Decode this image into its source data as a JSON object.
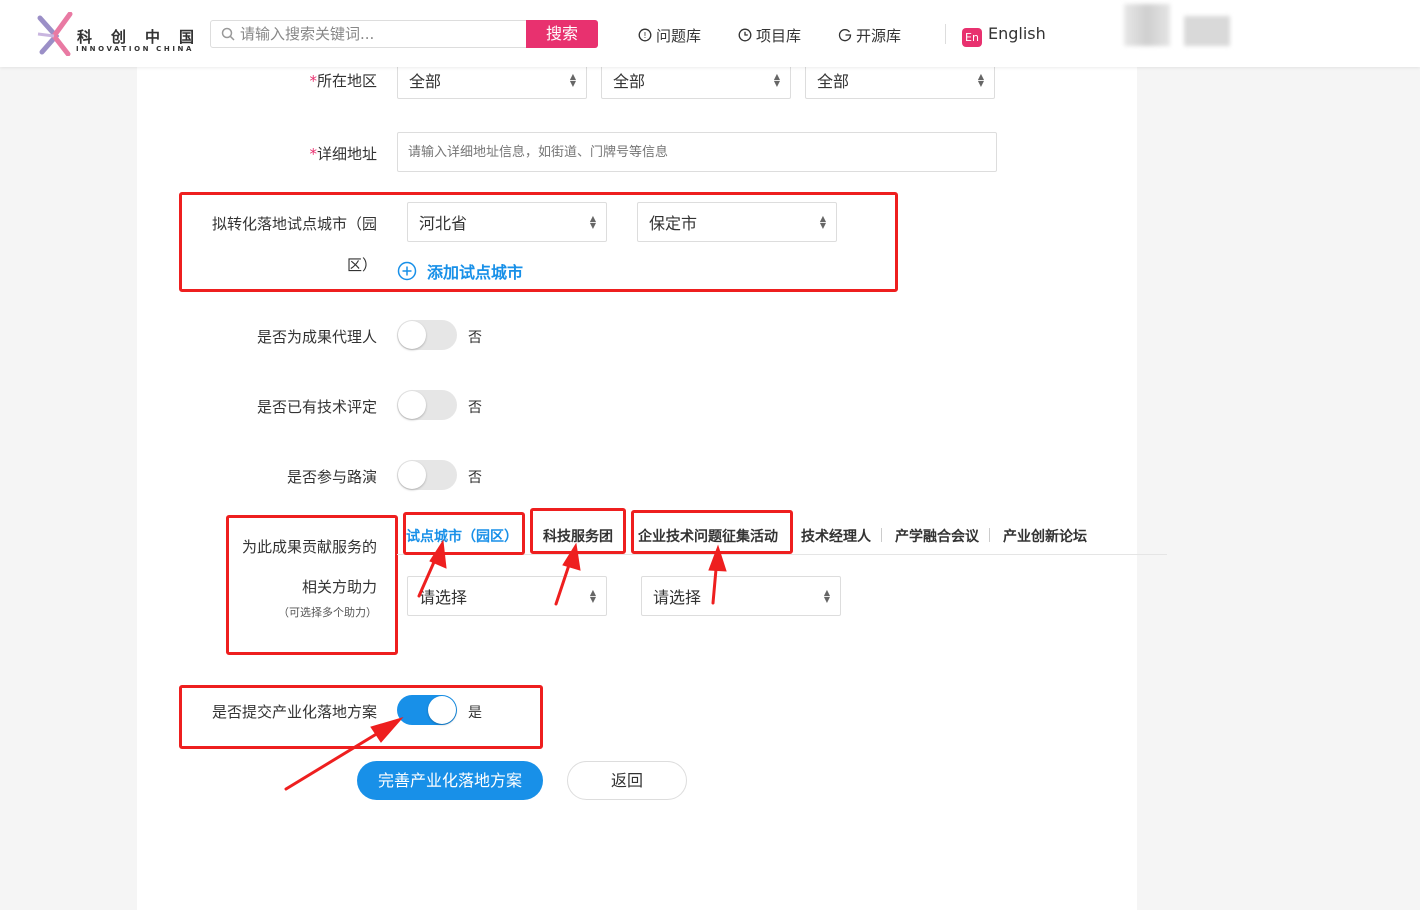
{
  "header": {
    "logo_cn": "科创中国",
    "logo_en": "INNOVATION CHINA",
    "search_placeholder": "请输入搜索关键词...",
    "search_button": "搜索",
    "nav": [
      {
        "label": "问题库",
        "icon": "question-circle-icon"
      },
      {
        "label": "项目库",
        "icon": "clock-icon"
      },
      {
        "label": "开源库",
        "icon": "refresh-g-icon"
      }
    ],
    "language_icon_text": "En",
    "language_label": "English"
  },
  "form": {
    "region": {
      "required_mark": "*",
      "label": "所在地区",
      "selects": [
        "全部",
        "全部",
        "全部"
      ]
    },
    "address": {
      "required_mark": "*",
      "label": "详细地址",
      "placeholder": "请输入详细地址信息，如街道、门牌号等信息"
    },
    "pilot_city": {
      "label_line1": "拟转化落地试点城市（园",
      "label_line2": "区）",
      "province": "河北省",
      "city": "保定市",
      "add_button": "添加试点城市"
    },
    "is_agent": {
      "label": "是否为成果代理人",
      "value_text": "否",
      "on": false
    },
    "has_tech_eval": {
      "label": "是否已有技术评定",
      "value_text": "否",
      "on": false
    },
    "join_roadshow": {
      "label": "是否参与路演",
      "value_text": "否",
      "on": false
    },
    "helpers": {
      "label_line1": "为此成果贡献服务的",
      "label_line2": "相关方助力",
      "label_note": "（可选择多个助力）",
      "tabs": [
        "试点城市（园区）",
        "科技服务团",
        "企业技术问题征集活动",
        "技术经理人",
        "产学融合会议",
        "产业创新论坛"
      ],
      "active_tab": "试点城市（园区）",
      "select_1": "请选择",
      "select_2": "请选择"
    },
    "submit_plan": {
      "label": "是否提交产业化落地方案",
      "value_text": "是",
      "on": true
    },
    "buttons": {
      "primary": "完善产业化落地方案",
      "back": "返回"
    }
  },
  "colors": {
    "brand_pink": "#e8316f",
    "accent_blue": "#1890e8",
    "annotation_red": "#ee1f1f"
  }
}
